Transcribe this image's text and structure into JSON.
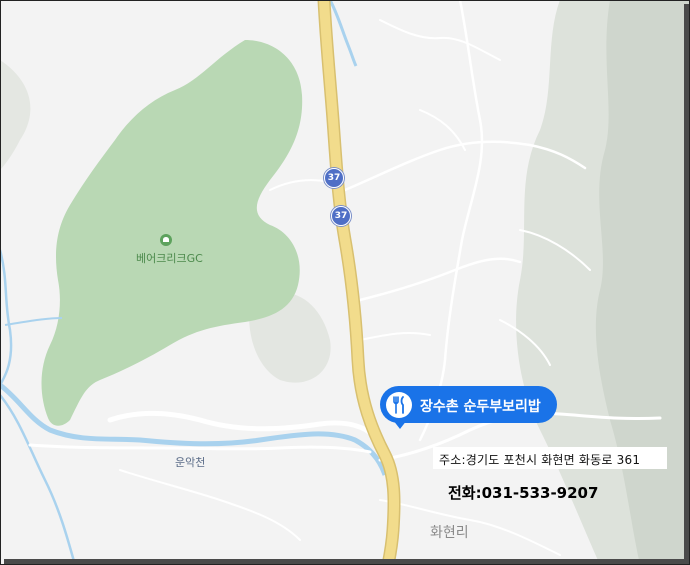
{
  "map": {
    "colors": {
      "background": "#f2f2f2",
      "golf_course": "#b9d8b4",
      "terrain": "#d6dcd4",
      "water": "#a9d2ee",
      "highway": "#f2dc8c",
      "road": "#ffffff",
      "marker": "#1a73e8"
    },
    "golf_course": {
      "name": "베어크리크GC",
      "icon": "golf-icon"
    },
    "river_label": "운악천",
    "village_label": "화현리",
    "route_shields": [
      "37",
      "37"
    ],
    "marker": {
      "name": "장수촌 순두부보리밥",
      "icon": "restaurant-fork-knife-icon"
    },
    "address": "주소:경기도 포천시 화현면 화동로 361",
    "phone": "전화:031-533-9207"
  }
}
